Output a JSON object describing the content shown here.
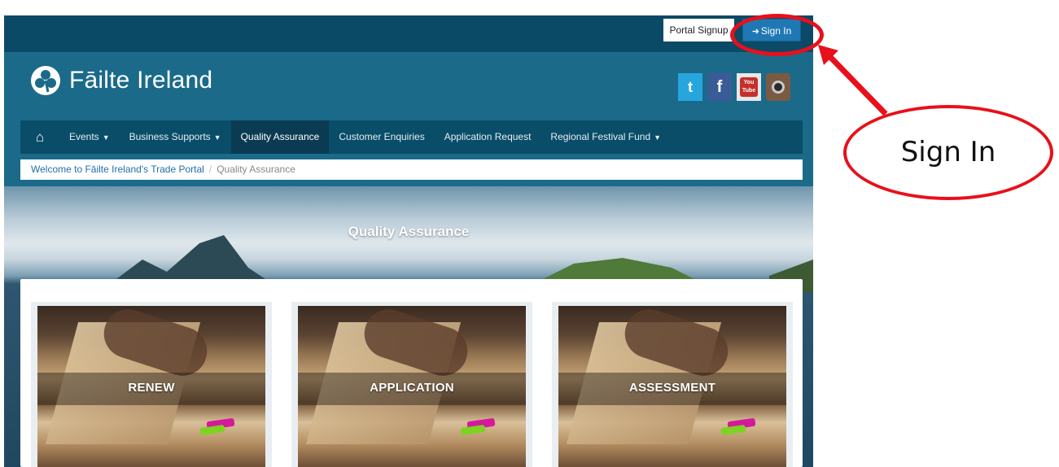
{
  "topbar": {
    "portal_signup_label": "Portal Signup",
    "sign_in_label": "Sign In",
    "sign_in_icon": "sign-in-icon"
  },
  "header": {
    "logo_text": "Fāilte Ireland",
    "social": [
      "twitter-icon",
      "facebook-icon",
      "youtube-icon",
      "instagram-icon"
    ],
    "youtube_text_top": "You",
    "youtube_text_bottom": "Tube"
  },
  "nav": {
    "home_icon": "home-icon",
    "items": [
      {
        "label": "Events",
        "dropdown": true
      },
      {
        "label": "Business Supports",
        "dropdown": true
      },
      {
        "label": "Quality Assurance",
        "active": true
      },
      {
        "label": "Customer Enquiries"
      },
      {
        "label": "Application Request"
      },
      {
        "label": "Regional Festival Fund",
        "dropdown": true
      }
    ]
  },
  "breadcrumb": {
    "home": "Welcome to Fāilte Ireland's Trade Portal",
    "separator": "/",
    "current": "Quality Assurance"
  },
  "hero": {
    "title": "Quality Assurance"
  },
  "cards": [
    {
      "label": "RENEW"
    },
    {
      "label": "APPLICATION"
    },
    {
      "label": "ASSESSMENT"
    }
  ],
  "annotation": {
    "callout_text": "Sign In",
    "color": "#e8101a"
  },
  "colors": {
    "topbar": "#0b4a66",
    "header": "#1b6a8a",
    "nav": "#094d68",
    "nav_active": "#0a3b52",
    "sign_in_button": "#1f78b4",
    "link": "#1f6fa8"
  }
}
